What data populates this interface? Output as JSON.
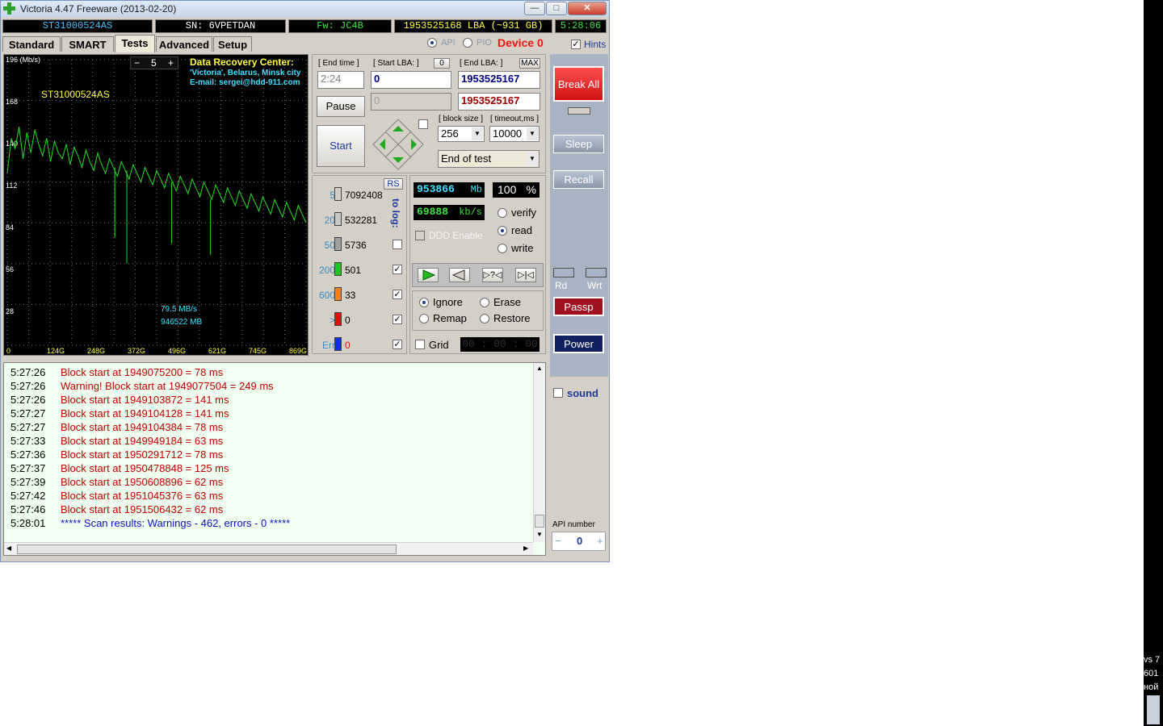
{
  "window": {
    "title": "Victoria 4.47  Freeware (2013-02-20)"
  },
  "status": {
    "model": "ST31000524AS",
    "serial": "SN: 6VPETDAN",
    "firmware": "Fw: JC4B",
    "lba": "1953525168 LBA (~931 GB)",
    "clock": "5:28:06"
  },
  "tabs": [
    "Standard",
    "SMART",
    "Tests",
    "Advanced",
    "Setup"
  ],
  "mode": {
    "api_label": "API",
    "pio_label": "PIO",
    "device_label": "Device 0",
    "hints_label": "Hints"
  },
  "graph": {
    "y_ticks": [
      "196 (Mb/s)",
      "168",
      "140",
      "112",
      "84",
      "56",
      "28"
    ],
    "x_ticks": [
      "0",
      "124G",
      "248G",
      "372G",
      "496G",
      "621G",
      "745G",
      "869G"
    ],
    "zoom_minus": "−",
    "zoom_value": "5",
    "zoom_plus": "+",
    "drc_title": "Data Recovery Center:",
    "drc_line1": "'Victoria', Belarus, Minsk city",
    "drc_line2": "E-mail: sergei@hdd-911.com",
    "model_label": "ST31000524AS",
    "speed_label": "79.5 MB/s",
    "pos_label": "946522 MB"
  },
  "chart_data": {
    "type": "line",
    "series": [
      {
        "y": [
          118,
          142,
          135,
          150,
          128,
          146,
          132,
          148,
          138,
          130,
          142,
          126,
          140,
          132,
          128,
          138,
          124,
          136,
          130,
          122,
          134,
          126,
          120,
          132,
          124,
          118,
          128,
          122,
          116,
          126,
          120,
          114,
          124,
          118,
          112,
          122,
          116,
          110,
          120,
          114,
          108,
          118,
          112,
          106,
          116,
          110,
          104,
          114,
          108,
          102,
          112,
          106,
          100,
          110,
          104,
          98,
          108,
          102,
          96,
          106,
          100,
          94,
          104,
          98,
          92,
          102,
          96,
          90,
          100,
          94,
          88,
          98,
          92,
          86,
          96,
          90,
          84
        ]
      }
    ],
    "dips": [
      [
        0.4,
        56
      ],
      [
        0.55,
        70
      ],
      [
        0.68,
        62
      ],
      [
        0.36,
        74
      ]
    ],
    "ylim": [
      0,
      196
    ],
    "xlim": [
      0,
      931
    ],
    "grid": true
  },
  "controls": {
    "end_time_label": "[ End time ]",
    "end_time_value": "2:24",
    "start_lba_label": "[ Start LBA: ]",
    "start_lba_btn": "0",
    "end_lba_label": "[ End LBA: ]",
    "end_lba_btn": "MAX",
    "start_lba_value": "0",
    "end_lba_value": "1953525167",
    "cur_lba_value": "0",
    "cur_end_value": "1953525167",
    "pause_label": "Pause",
    "start_label": "Start",
    "block_size_label": "[ block size ]",
    "block_size_value": "256",
    "timeout_label": "[ timeout,ms ]",
    "timeout_value": "10000",
    "end_action": "End of test"
  },
  "counters": {
    "rs_label": "RS",
    "to_log": "to log:",
    "rows": [
      {
        "label": "5",
        "value": "7092408",
        "color": "#d4d0c8"
      },
      {
        "label": "20",
        "value": "532281",
        "color": "#c8c8c8"
      },
      {
        "label": "50",
        "value": "5736",
        "color": "#a0a0a0"
      },
      {
        "label": "200",
        "value": "501",
        "color": "#22c022"
      },
      {
        "label": "600",
        "value": "33",
        "color": "#f08020"
      },
      {
        "label": ">",
        "value": "0",
        "color": "#e01010"
      },
      {
        "label": "Err",
        "value": "0",
        "color": "#1030e0"
      }
    ]
  },
  "stats": {
    "mb": "953866",
    "mb_unit": "Mb",
    "pct": "100",
    "pct_unit": "%",
    "speed": "69888",
    "speed_unit": "kb/s",
    "ddd_label": "DDD Enable",
    "verify": "verify",
    "read": "read",
    "write": "write",
    "ignore": "Ignore",
    "erase": "Erase",
    "remap": "Remap",
    "restore": "Restore",
    "grid_label": "Grid",
    "timer": "00 : 00 : 00"
  },
  "right": {
    "break_all": "Break All",
    "sleep": "Sleep",
    "recall": "Recall",
    "rd": "Rd",
    "wrt": "Wrt",
    "passp": "Passp",
    "power": "Power",
    "sound": "sound",
    "api_number_label": "API number",
    "api_number_value": "0",
    "api_minus": "−",
    "api_plus": "+"
  },
  "log": [
    {
      "time": "5:27:26",
      "msg": "Block start at 1949075200 = 78 ms",
      "kind": "err"
    },
    {
      "time": "5:27:26",
      "msg": "Warning! Block start at 1949077504 = 249 ms",
      "kind": "err"
    },
    {
      "time": "5:27:26",
      "msg": "Block start at 1949103872 = 141 ms",
      "kind": "err"
    },
    {
      "time": "5:27:27",
      "msg": "Block start at 1949104128 = 141 ms",
      "kind": "err"
    },
    {
      "time": "5:27:27",
      "msg": "Block start at 1949104384 = 78 ms",
      "kind": "err"
    },
    {
      "time": "5:27:33",
      "msg": "Block start at 1949949184 = 63 ms",
      "kind": "err"
    },
    {
      "time": "5:27:36",
      "msg": "Block start at 1950291712 = 78 ms",
      "kind": "err"
    },
    {
      "time": "5:27:37",
      "msg": "Block start at 1950478848 = 125 ms",
      "kind": "err"
    },
    {
      "time": "5:27:39",
      "msg": "Block start at 1950608896 = 62 ms",
      "kind": "err"
    },
    {
      "time": "5:27:42",
      "msg": "Block start at 1951045376 = 63 ms",
      "kind": "err"
    },
    {
      "time": "5:27:46",
      "msg": "Block start at 1951506432 = 62 ms",
      "kind": "err"
    },
    {
      "time": "5:28:01",
      "msg": "***** Scan results: Warnings - 462, errors - 0 *****",
      "kind": "info"
    }
  ],
  "desktop_edge": {
    "line1": "vs 7",
    "line2": "601",
    "line3": "ной"
  },
  "colors": {
    "graph_line": "#22dd22",
    "error_text": "#c00000",
    "info_text": "#1010c0",
    "drc_title": "#ffff40",
    "drc_text": "#40e0ff"
  }
}
